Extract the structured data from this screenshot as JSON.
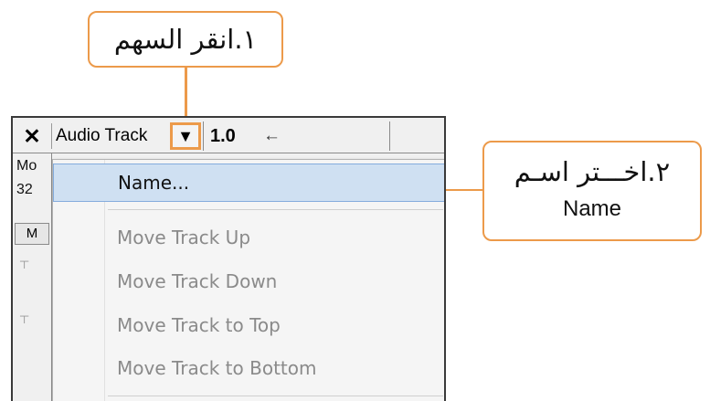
{
  "callouts": {
    "step1": "١.انقر السهم",
    "step2_line1": "٢.اخـــتر اسـم",
    "step2_line2": "Name"
  },
  "track_header": {
    "close_label": "✕",
    "track_name": "Audio Track",
    "menu_arrow": "▼",
    "gain": "1.0",
    "left_arrow_icon": "←"
  },
  "side_panel": {
    "line1": "Mo",
    "line2": "32",
    "button": "M"
  },
  "menu": {
    "items": [
      {
        "label": "Name...",
        "enabled": true,
        "selected": true
      },
      {
        "label": "Move Track Up",
        "enabled": false
      },
      {
        "label": "Move Track Down",
        "enabled": false
      },
      {
        "label": "Move Track to Top",
        "enabled": false
      },
      {
        "label": "Move Track to Bottom",
        "enabled": false
      }
    ]
  },
  "colors": {
    "callout_accent": "#ec9a4a",
    "selection_bg": "#cfe0f2",
    "selection_border": "#84acdd",
    "disabled_text": "#8a8a8a"
  }
}
